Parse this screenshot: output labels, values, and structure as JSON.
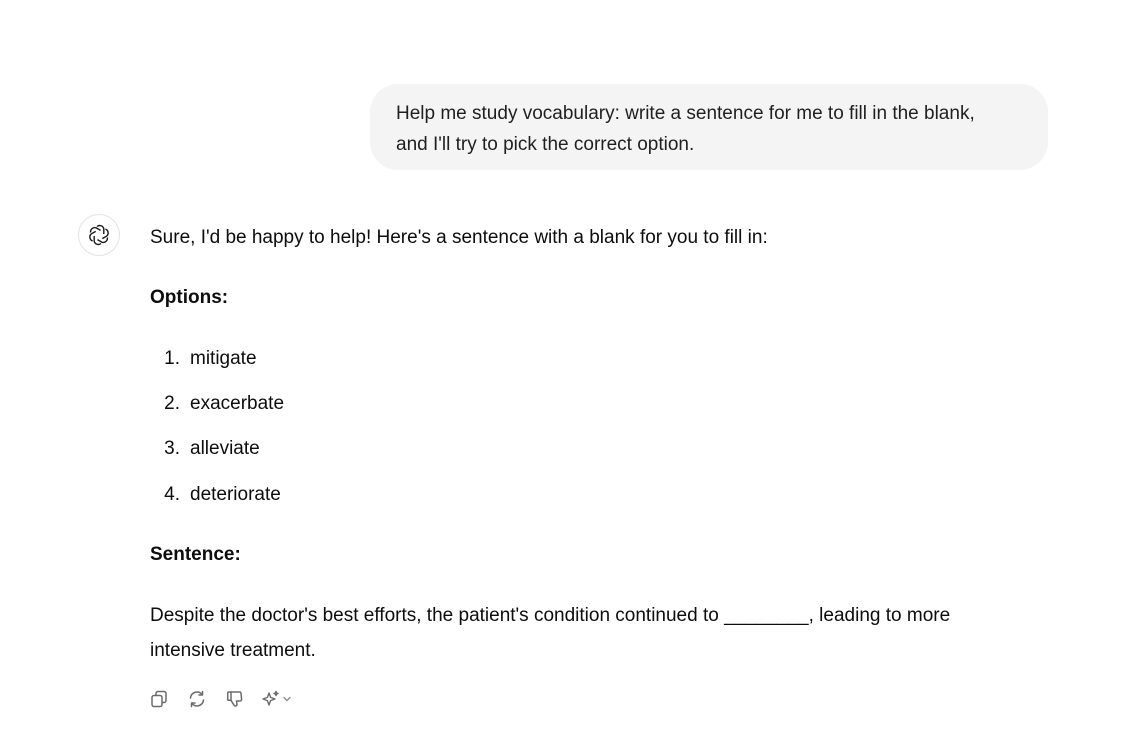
{
  "user_message": {
    "lines": [
      "Help me study vocabulary: write a sentence for me to fill in the blank,",
      "and I'll try to pick the correct option."
    ]
  },
  "assistant": {
    "avatar_icon": "openai-logo-icon",
    "intro": "Sure, I'd be happy to help! Here's a sentence with a blank for you to fill in:",
    "options_heading": "Options:",
    "options": [
      {
        "num": "1.",
        "word": "mitigate"
      },
      {
        "num": "2.",
        "word": "exacerbate"
      },
      {
        "num": "3.",
        "word": "alleviate"
      },
      {
        "num": "4.",
        "word": "deteriorate"
      }
    ],
    "sentence_heading": "Sentence:",
    "sentence_lines": [
      "Despite the doctor's best efforts, the patient's condition continued to ________, leading to more",
      "intensive treatment."
    ]
  },
  "toolbar": {
    "icons": [
      "copy-icon",
      "regenerate-icon",
      "thumbs-down-icon",
      "sparkle-icon",
      "chevron-down-icon"
    ]
  }
}
